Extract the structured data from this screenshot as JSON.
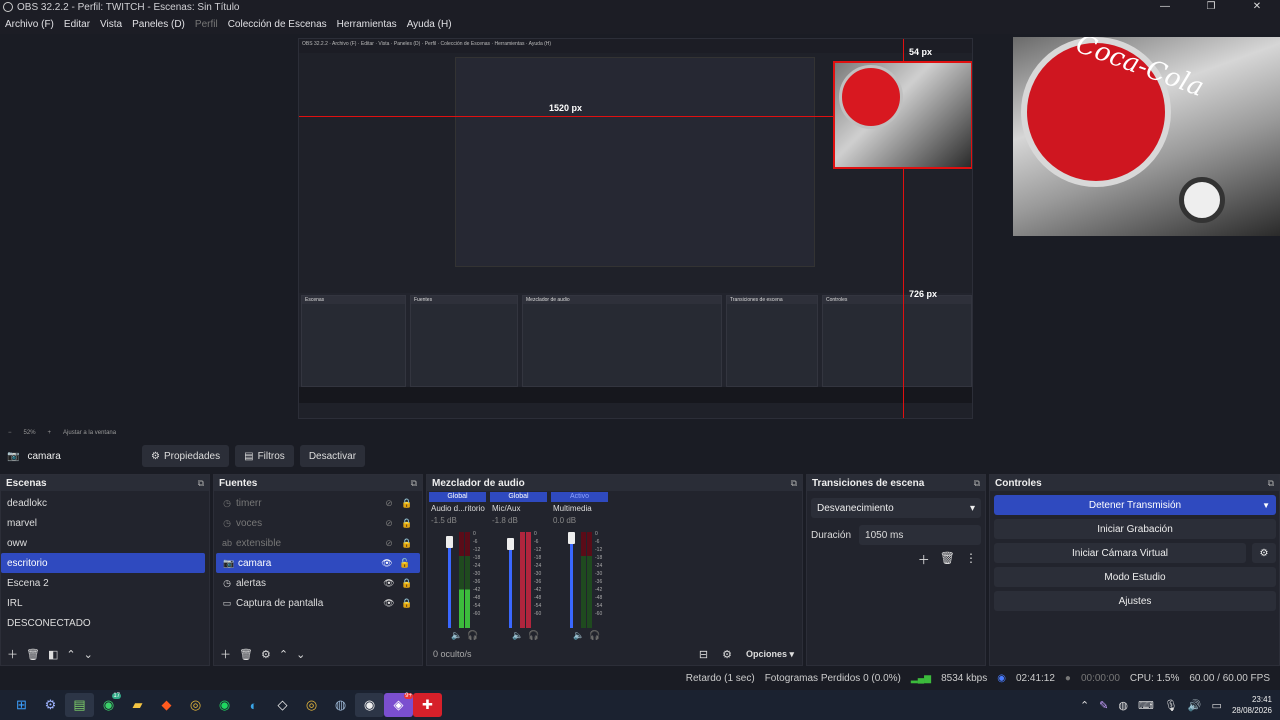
{
  "window": {
    "title": "OBS 32.2.2 - Perfil: TWITCH - Escenas: Sin Título",
    "controls": [
      "—",
      "❐",
      "✕"
    ]
  },
  "menu": [
    {
      "label": "Archivo (F)",
      "disabled": false
    },
    {
      "label": "Editar",
      "disabled": false
    },
    {
      "label": "Vista",
      "disabled": false
    },
    {
      "label": "Paneles (D)",
      "disabled": false
    },
    {
      "label": "Perfil",
      "disabled": true
    },
    {
      "label": "Colección de Escenas",
      "disabled": false
    },
    {
      "label": "Herramientas",
      "disabled": false
    },
    {
      "label": "Ayuda (H)",
      "disabled": false
    }
  ],
  "preview": {
    "measure_top": "54 px",
    "measure_left": "1520 px",
    "measure_bottom": "726 px",
    "nested_measure_top": "726 px",
    "cam_text": "Coca-Cola"
  },
  "zoom": {
    "minus": "−",
    "value": "52%",
    "plus": "+",
    "fit": "Ajustar a la ventana"
  },
  "source_toolbar": {
    "source_name": "camara",
    "properties_label": "Propiedades",
    "filters_label": "Filtros",
    "deactivate_label": "Desactivar"
  },
  "scenes": {
    "title": "Escenas",
    "items": [
      "deadlokc",
      "marvel",
      "oww",
      "escritorio",
      "Escena 2",
      "IRL",
      "DESCONECTADO"
    ],
    "selected_index": 3
  },
  "sources": {
    "title": "Fuentes",
    "items": [
      {
        "name": "timerr",
        "icon": "clock",
        "visible": false
      },
      {
        "name": "voces",
        "icon": "clock",
        "visible": false
      },
      {
        "name": "extensible",
        "icon": "text",
        "visible": false
      },
      {
        "name": "camara",
        "icon": "camera",
        "visible": true
      },
      {
        "name": "alertas",
        "icon": "clock",
        "visible": true
      },
      {
        "name": "Captura de pantalla",
        "icon": "monitor",
        "visible": true
      }
    ],
    "selected_index": 3
  },
  "mixer": {
    "title": "Mezclador de audio",
    "channels": [
      {
        "badge": "Global",
        "name": "Audio d...ritorio",
        "db": "-1.5 dB",
        "level": 0.88
      },
      {
        "badge": "Global",
        "name": "Mic/Aux",
        "db": "-1.8 dB",
        "level": 0.87
      },
      {
        "badge": "Activo",
        "name": "Multimedia",
        "db": "0.0 dB",
        "level": 1.0
      }
    ],
    "scale": [
      "0",
      "-6",
      "-12",
      "-18",
      "-24",
      "-30",
      "-36",
      "-42",
      "-48",
      "-54",
      "-60"
    ],
    "hidden_label": "0 oculto/s",
    "options_label": "Opciones"
  },
  "transitions": {
    "title": "Transiciones de escena",
    "selected": "Desvanecimiento",
    "duration_label": "Duración",
    "duration_value": "1050 ms"
  },
  "controls": {
    "title": "Controles",
    "stop_stream": "Detener Transmisión",
    "start_recording": "Iniciar Grabación",
    "start_virtual_cam": "Iniciar Cámara Virtual",
    "studio_mode": "Modo Estudio",
    "settings": "Ajustes"
  },
  "status": {
    "delay": "Retardo (1 sec)",
    "dropped_frames": "Fotogramas Perdidos 0 (0.0%)",
    "bitrate": "8534 kbps",
    "stream_time": "02:41:12",
    "record_time": "00:00:00",
    "cpu": "CPU: 1.5%",
    "fps": "60.00 / 60.00 FPS"
  },
  "taskbar": {
    "time": "23:41",
    "date": "28/08/2026",
    "whatsapp_badge": "17",
    "discord_badge": "9+"
  },
  "colors": {
    "accent": "#2f4abf",
    "guide": "#e01010",
    "meter_green": "#3cbb3c",
    "meter_red": "#b0253d"
  }
}
